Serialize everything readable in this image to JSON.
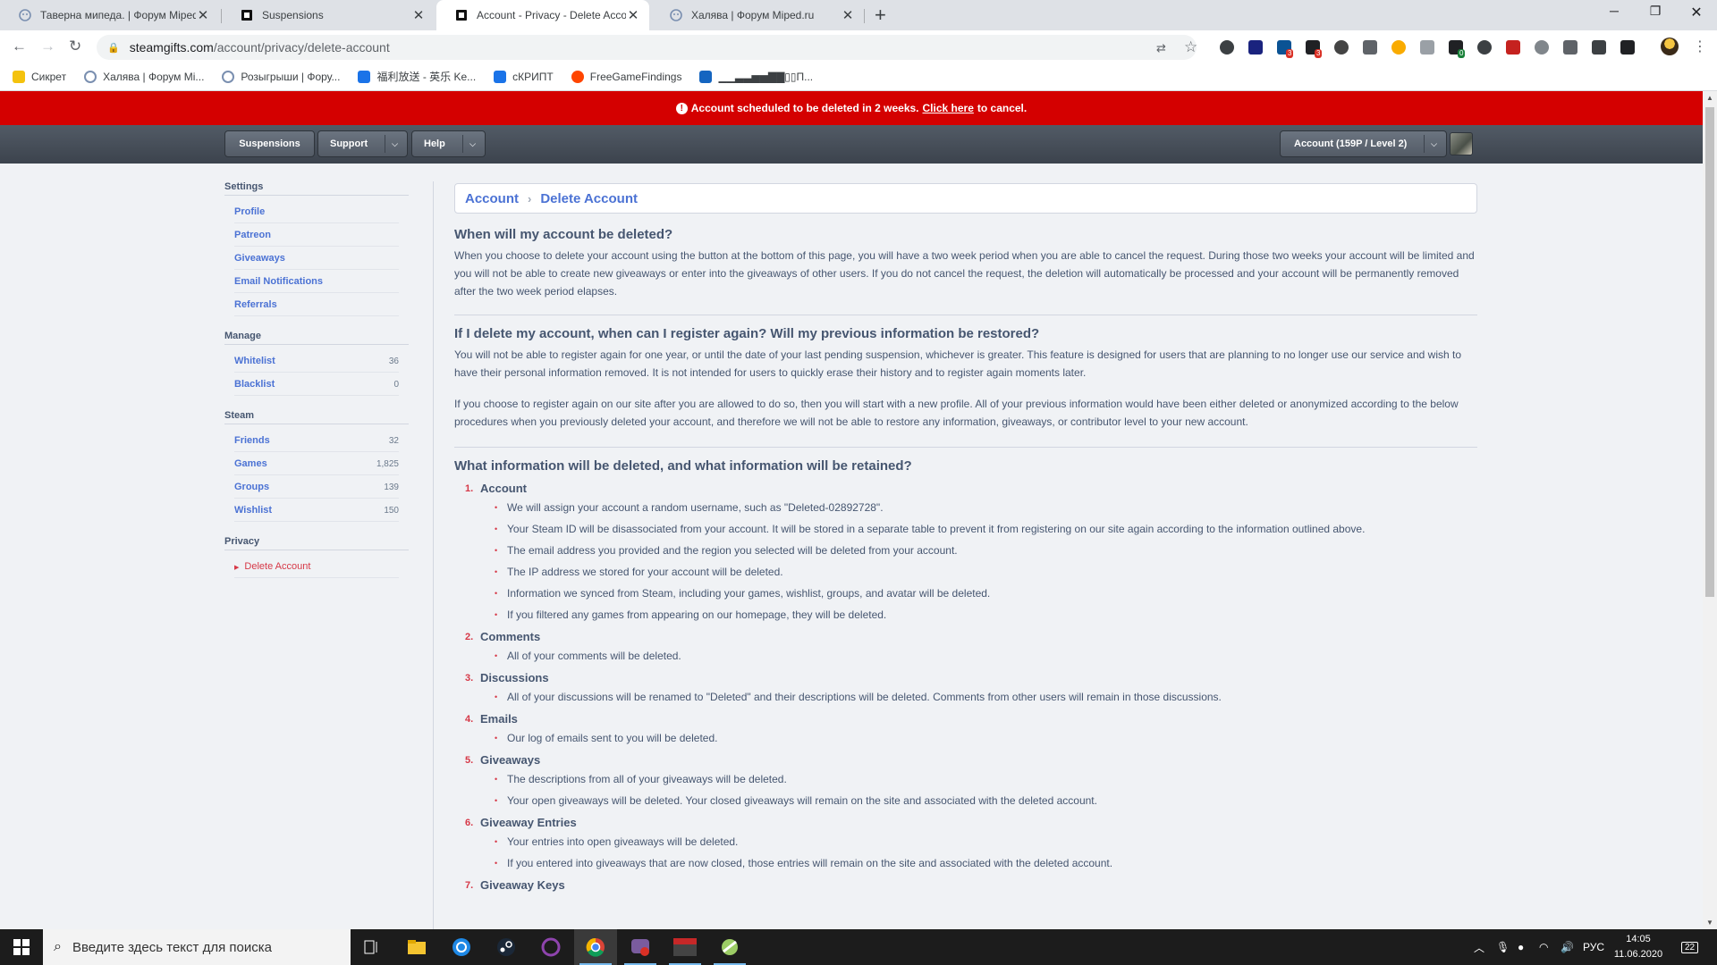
{
  "browser": {
    "tabs": [
      {
        "title": "Таверна мипеда. | Форум Miped.ru",
        "active": false
      },
      {
        "title": "Suspensions",
        "active": false
      },
      {
        "title": "Account - Privacy - Delete Account",
        "active": true
      },
      {
        "title": "Халява | Форум Miped.ru",
        "active": false
      }
    ],
    "new_tab": "+",
    "url_host": "steamgifts.com",
    "url_path": "/account/privacy/delete-account",
    "bookmarks": [
      "Сикрет",
      "Халява | Форум Mi...",
      "Розыгрыши | Фору...",
      "福利放送 - 英乐 Ke...",
      "сКРИПТ",
      "FreeGameFindings",
      "▁▁▃▃▅▅▇▇▯▯П..."
    ],
    "ext_badges": [
      "3",
      "3",
      "0"
    ]
  },
  "notice": {
    "text": "Account scheduled to be deleted in 2 weeks.",
    "link": "Click here",
    "suffix": "to cancel.",
    "color": "#d40000"
  },
  "nav": {
    "suspensions": "Suspensions",
    "support": "Support",
    "help": "Help",
    "account": "Account (159P / Level 2)"
  },
  "sidebar": {
    "settings": {
      "heading": "Settings",
      "items": [
        {
          "label": "Profile"
        },
        {
          "label": "Patreon"
        },
        {
          "label": "Giveaways"
        },
        {
          "label": "Email Notifications"
        },
        {
          "label": "Referrals"
        }
      ]
    },
    "manage": {
      "heading": "Manage",
      "items": [
        {
          "label": "Whitelist",
          "count": "36"
        },
        {
          "label": "Blacklist",
          "count": "0"
        }
      ]
    },
    "steam": {
      "heading": "Steam",
      "items": [
        {
          "label": "Friends",
          "count": "32"
        },
        {
          "label": "Games",
          "count": "1,825"
        },
        {
          "label": "Groups",
          "count": "139"
        },
        {
          "label": "Wishlist",
          "count": "150"
        }
      ]
    },
    "privacy": {
      "heading": "Privacy",
      "items": [
        {
          "label": "Delete Account"
        }
      ]
    }
  },
  "content": {
    "breadcrumb": {
      "root": "Account",
      "sep": "›",
      "current": "Delete Account"
    },
    "q1": {
      "title": "When will my account be deleted?",
      "text": "When you choose to delete your account using the button at the bottom of this page, you will have a two week period when you are able to cancel the request. During those two weeks your account will be limited and you will not be able to create new giveaways or enter into the giveaways of other users. If you do not cancel the request, the deletion will automatically be processed and your account will be permanently removed after the two week period elapses."
    },
    "q2": {
      "title": "If I delete my account, when can I register again? Will my previous information be restored?",
      "text1": "You will not be able to register again for one year, or until the date of your last pending suspension, whichever is greater. This feature is designed for users that are planning to no longer use our service and wish to have their personal information removed. It is not intended for users to quickly erase their history and to register again moments later.",
      "text2": "If you choose to register again on our site after you are allowed to do so, then you will start with a new profile. All of your previous information would have been either deleted or anonymized according to the below procedures when you previously deleted your account, and therefore we will not be able to restore any information, giveaways, or contributor level to your new account."
    },
    "q3": {
      "title": "What information will be deleted, and what information will be retained?",
      "items": [
        {
          "num": "1.",
          "title": "Account",
          "bullets": [
            "We will assign your account a random username, such as \"Deleted-02892728\".",
            "Your Steam ID will be disassociated from your account. It will be stored in a separate table to prevent it from registering on our site again according to the information outlined above.",
            "The email address you provided and the region you selected will be deleted from your account.",
            "The IP address we stored for your account will be deleted.",
            "Information we synced from Steam, including your games, wishlist, groups, and avatar will be deleted.",
            "If you filtered any games from appearing on our homepage, they will be deleted."
          ]
        },
        {
          "num": "2.",
          "title": "Comments",
          "bullets": [
            "All of your comments will be deleted."
          ]
        },
        {
          "num": "3.",
          "title": "Discussions",
          "bullets": [
            "All of your discussions will be renamed to \"Deleted\" and their descriptions will be deleted. Comments from other users will remain in those discussions."
          ]
        },
        {
          "num": "4.",
          "title": "Emails",
          "bullets": [
            "Our log of emails sent to you will be deleted."
          ]
        },
        {
          "num": "5.",
          "title": "Giveaways",
          "bullets": [
            "The descriptions from all of your giveaways will be deleted.",
            "Your open giveaways will be deleted. Your closed giveaways will remain on the site and associated with the deleted account."
          ]
        },
        {
          "num": "6.",
          "title": "Giveaway Entries",
          "bullets": [
            "Your entries into open giveaways will be deleted.",
            "If you entered into giveaways that are now closed, those entries will remain on the site and associated with the deleted account."
          ]
        },
        {
          "num": "7.",
          "title": "Giveaway Keys",
          "bullets": []
        }
      ]
    }
  },
  "taskbar": {
    "search_placeholder": "Введите здесь текст для поиска",
    "lang": "РУС",
    "time": "14:05",
    "date": "11.06.2020",
    "notif_count": "22"
  }
}
